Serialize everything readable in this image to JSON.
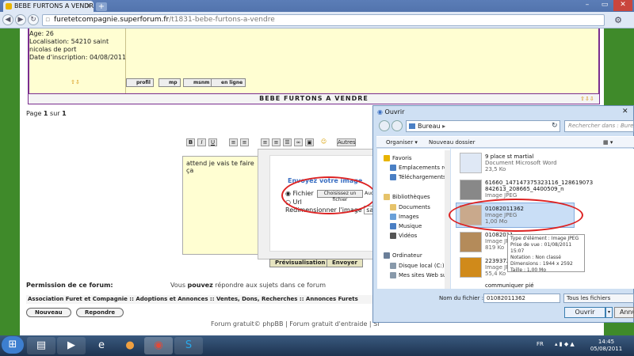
{
  "browser": {
    "tab_title": "BEBE FURTONS A VENDRE",
    "url_domain": "furetetcompagnie.superforum.fr",
    "url_path": "/t1831-bebe-furtons-a-vendre",
    "window_controls": [
      "–",
      "▭",
      "✕"
    ]
  },
  "profile": {
    "age": "Age: 26",
    "location_line1": "Localisation: 54210 saint",
    "location_line2": "nicolas de port",
    "joined": "Date d'inscription: 04/08/2011",
    "buttons": [
      "profil",
      "mp",
      "msnm",
      "en ligne"
    ]
  },
  "post": {
    "title": "BEBE FURTONS A VENDRE",
    "pager_prefix": "Page ",
    "pager_current": "1",
    "pager_mid": " sur ",
    "pager_total": "1"
  },
  "editor": {
    "buttons": [
      "B",
      "I",
      "U",
      "S"
    ],
    "autres": "Autres",
    "text": "attend je vais te faire ça",
    "upload_title": "Envoyez votre image",
    "file_label": "Fichier",
    "choose_button": "Choisissez un fichier",
    "file_suffix": "Auc",
    "url_label": "Url",
    "resize_label": "Redimensionner l'image",
    "resize_value": "sans",
    "preview_button": "Prévisualisation",
    "send_button": "Envoyer"
  },
  "forum": {
    "permission_label": "Permission de ce forum:",
    "permission_prefix": "Vous ",
    "permission_strong": "pouvez",
    "permission_suffix": " répondre aux sujets dans ce forum",
    "breadcrumb": "Association Furet et Compagnie :: Adoptions et Annonces :: Ventes, Dons, Recherches :: Annonces Furets",
    "new_button": "Nouveau",
    "reply_button": "Repondre",
    "footer": "Forum gratuit© phpBB | Forum gratuit d'entraide | Si"
  },
  "dialog": {
    "title": "Ouvrir",
    "location": "Bureau",
    "search_placeholder": "Rechercher dans : Bureau",
    "organize": "Organiser ▾",
    "new_folder": "Nouveau dossier",
    "nav_items": [
      {
        "label": "Favoris",
        "color": "#e8b400"
      },
      {
        "label": "Emplacements ré",
        "color": "#4a7fc4"
      },
      {
        "label": "Téléchargements",
        "color": "#4a7fc4"
      },
      {
        "label": "Bibliothèques",
        "color": "#e6c36a"
      },
      {
        "label": "Documents",
        "color": "#e6c36a"
      },
      {
        "label": "Images",
        "color": "#e6c36a"
      },
      {
        "label": "Musique",
        "color": "#e6c36a"
      },
      {
        "label": "Vidéos",
        "color": "#e6c36a"
      },
      {
        "label": "Ordinateur",
        "color": "#6b7f99"
      },
      {
        "label": "Disque local (C:)",
        "color": "#8899aa"
      },
      {
        "label": "Mes sites Web su",
        "color": "#8899aa"
      }
    ],
    "files": [
      {
        "name": "9 place st martial",
        "type": "Document Microsoft Word",
        "size": "23,5 Ko"
      },
      {
        "name": "61660_147147375323116_128619073",
        "name2": "842613_208665_4400509_n",
        "type": "Image JPEG",
        "size": ""
      },
      {
        "name": "01082011362",
        "type": "Image JPEG",
        "size": "1,00 Mo"
      },
      {
        "name": "01082011",
        "type": "Image JPE",
        "size": "819 Ko"
      },
      {
        "name": "22393722",
        "type": "Image JPE",
        "size": "55,4 Ko"
      },
      {
        "name": "communiquer pié",
        "type": "",
        "size": ""
      }
    ],
    "tooltip": [
      "Type d'élément : Image JPEG",
      "Prise de vue : 01/08/2011 15:07",
      "Notation : Non classé",
      "Dimensions : 1944 x 2592",
      "Taille : 1,00 Mo"
    ],
    "filename_label": "Nom du fichier :",
    "filename_value": "01082011362",
    "filetype": "Tous les fichiers",
    "open_button": "Ouvrir",
    "cancel_button": "Annu"
  },
  "taskbar": {
    "lang": "FR",
    "time": "14:45",
    "date": "05/08/2011"
  }
}
